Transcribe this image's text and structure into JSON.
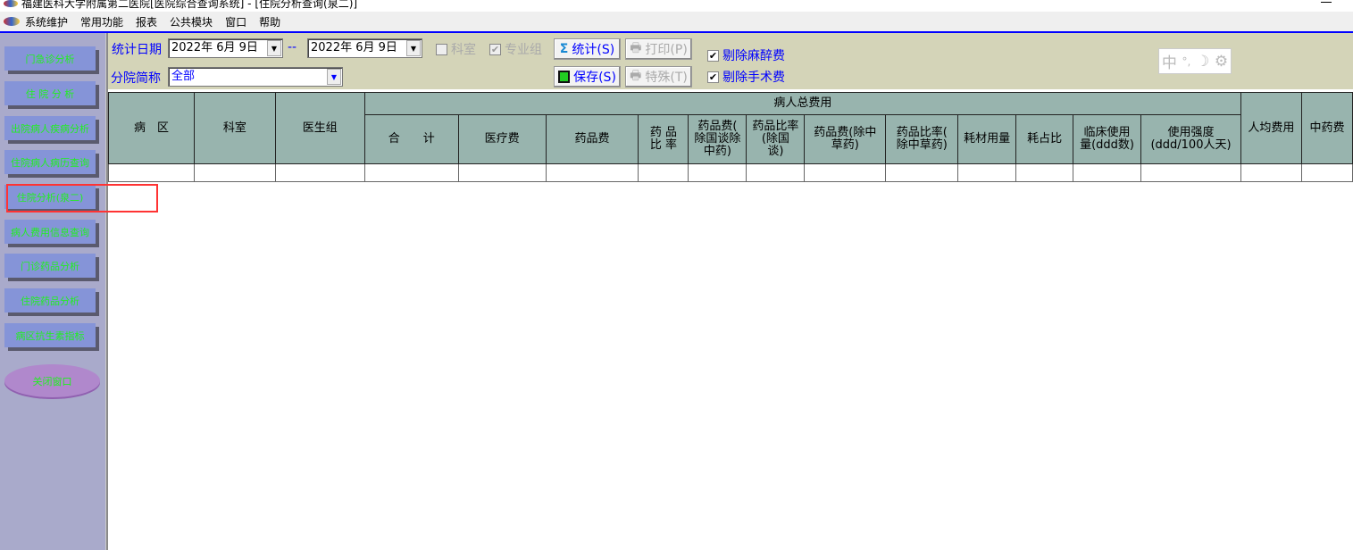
{
  "window": {
    "title": "福建医科大学附属第二医院[医院综合查询系统] - [住院分析查询(泉二)]"
  },
  "menu": [
    "系统维护",
    "常用功能",
    "报表",
    "公共模块",
    "窗口",
    "帮助"
  ],
  "sidebar": {
    "items": [
      "门急诊分析",
      "住 院 分 析",
      "出院病人疾病分析",
      "住院病人病历查询",
      "住院分析(泉二)",
      "病人费用信息查询",
      "门诊药品分析",
      "住院药品分析",
      "病区抗生素指标"
    ],
    "close": "关闭窗口",
    "selected_index": 4
  },
  "toolbar": {
    "date_label": "统计日期",
    "date_from": "2022年  6月  9日",
    "date_sep": "--",
    "date_to": "2022年  6月  9日",
    "branch_label": "分院简称",
    "branch_value": "全部",
    "dept_chk": "科室",
    "dept_checked": false,
    "group_chk": "专业组",
    "group_checked": true,
    "stat_btn": "统计(S)",
    "print_btn": "打印(P)",
    "save_btn": "保存(S)",
    "special_btn": "特殊(T)",
    "excl_anesthesia": "剔除麻醉费",
    "excl_anesthesia_checked": true,
    "excl_surgery": "剔除手术费",
    "excl_surgery_checked": true
  },
  "ime": {
    "lang": "中",
    "punct": "°,",
    "mode": "☽",
    "settings": "⚙"
  },
  "table": {
    "fixed_headers": [
      "病　区",
      "科室",
      "医生组"
    ],
    "group_header": "病人总费用",
    "sub_headers": [
      "合　　计",
      "医疗费",
      "药品费",
      "药 品\n比 率",
      "药品费(\n除国谈除\n中药)",
      "药品比率\n(除国\n谈)",
      "药品费(除中\n草药)",
      "药品比率(\n除中草药)",
      "耗材用量",
      "耗占比",
      "临床使用\n量(ddd数)",
      "使用强度\n(ddd/100人天)"
    ],
    "tail_headers": [
      "人均费用",
      "中药费"
    ]
  },
  "colors": {
    "sidebar_button": "#8594d8",
    "sidebar_text": "#22ee22",
    "header_bg": "#98b4ae",
    "toolbar_bg": "#d4d4b8",
    "label": "#0000ff"
  }
}
